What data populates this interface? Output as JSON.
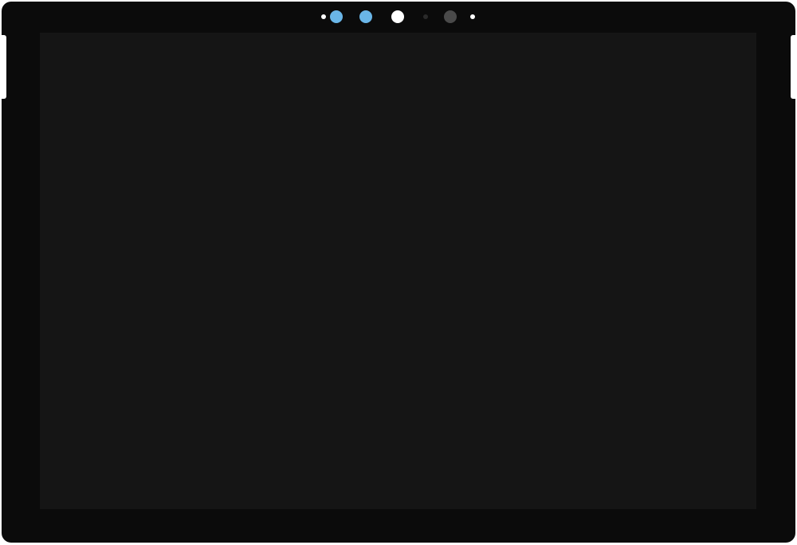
{
  "device": {
    "type": "tablet",
    "colors": {
      "bezel": "#0b0b0b",
      "screen": "#151515",
      "notch": "#ffffff",
      "ir_sensor": "#6ab6e8",
      "light_sensor": "#ffffff",
      "camera": "#4a4a4a",
      "indicator": "#ffffff",
      "mic": "#2a2a2a"
    },
    "sensors": [
      {
        "name": "left-indicator-dot",
        "icon": "dot-icon",
        "color": "#ffffff"
      },
      {
        "name": "left-ir-sensor",
        "icon": "ir-sensor-icon",
        "color": "#6ab6e8"
      },
      {
        "name": "right-ir-sensor",
        "icon": "ir-sensor-icon",
        "color": "#6ab6e8"
      },
      {
        "name": "ambient-light-sensor",
        "icon": "light-sensor-icon",
        "color": "#ffffff"
      },
      {
        "name": "microphone-dot",
        "icon": "mic-dot-icon",
        "color": "#2a2a2a"
      },
      {
        "name": "front-camera",
        "icon": "camera-icon",
        "color": "#4a4a4a"
      },
      {
        "name": "right-indicator-dot",
        "icon": "dot-icon",
        "color": "#ffffff"
      }
    ]
  }
}
